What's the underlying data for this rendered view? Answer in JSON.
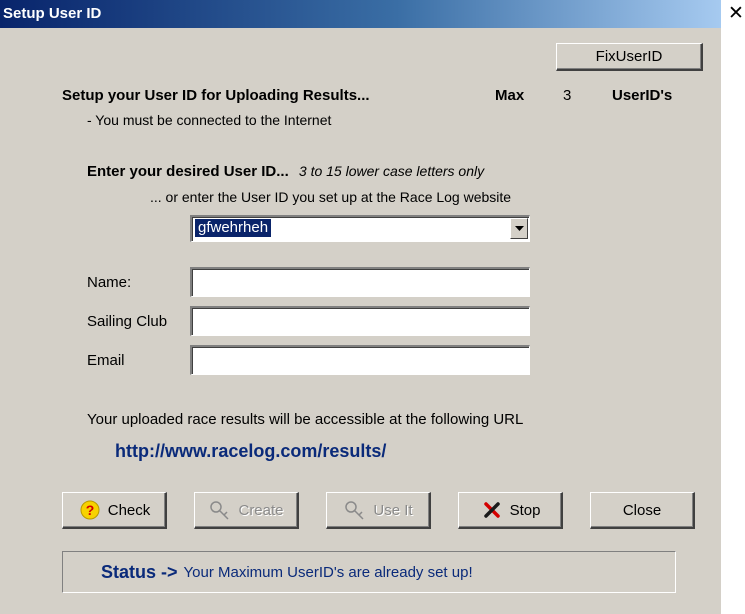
{
  "window": {
    "title": "Setup User ID",
    "close_glyph": "✕"
  },
  "fix_button_label": "FixUserID",
  "header": {
    "heading": "Setup your User ID for Uploading Results...",
    "max_label": "Max",
    "max_value": "3",
    "userids_label": "UserID's",
    "note": "- You must be connected to the Internet"
  },
  "userid": {
    "prompt": "Enter your desired User ID...",
    "hint": "3 to 15 lower case letters only",
    "alt_prompt": "... or enter the User ID you set up at the Race Log website",
    "selected_value": "gfwehrheh"
  },
  "form": {
    "name_label": "Name:",
    "club_label": "Sailing Club",
    "email_label": "Email",
    "name_value": "",
    "club_value": "",
    "email_value": ""
  },
  "url_section": {
    "note": "Your uploaded race results will be accessible at the following URL",
    "url": "http://www.racelog.com/results/"
  },
  "buttons": {
    "check": "Check",
    "create": "Create",
    "use_it": "Use It",
    "stop": "Stop",
    "close": "Close"
  },
  "status": {
    "title": "Status ->",
    "message": "Your Maximum UserID's are already set up!"
  },
  "icons": {
    "check": "help-question-icon",
    "create": "key-icon",
    "use_it": "key-icon",
    "stop": "red-x-icon",
    "dropdown": "chevron-down-icon"
  },
  "colors": {
    "title_bar_start": "#08246b",
    "title_bar_end": "#a6caf0",
    "dialog_bg": "#d4d0c8",
    "url_text": "#0a2a7a",
    "selection": "#0a246a"
  }
}
